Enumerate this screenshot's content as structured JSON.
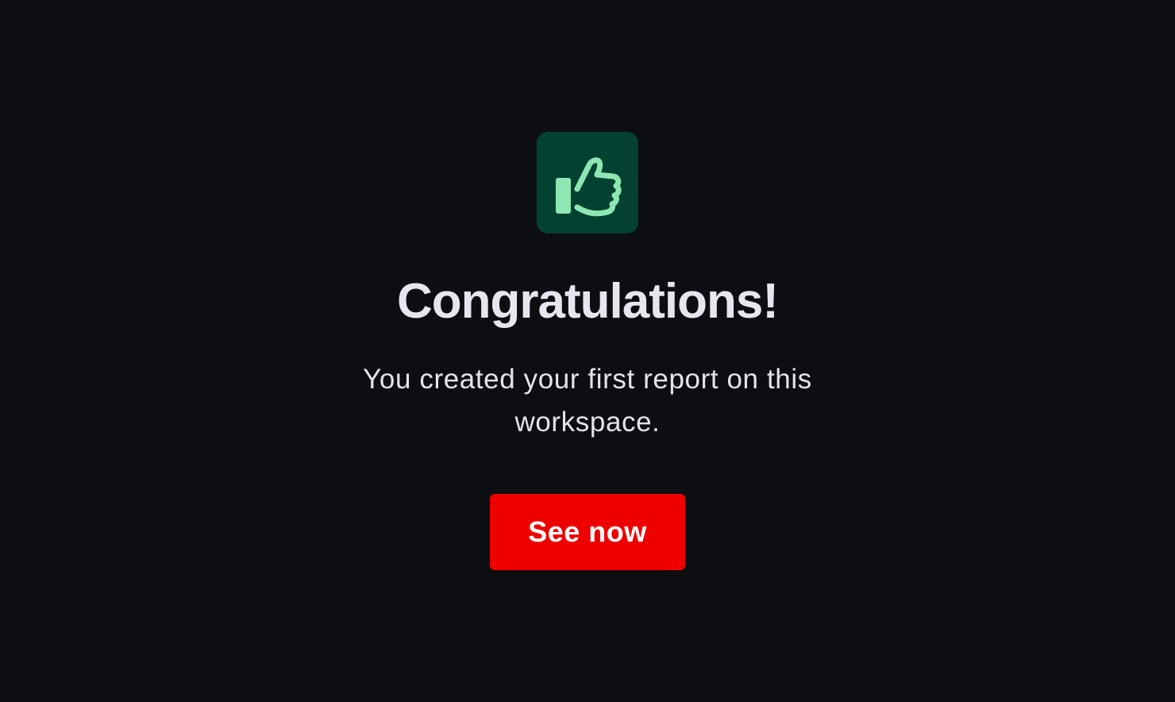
{
  "dialog": {
    "icon": "thumbs-up-icon",
    "title": "Congratulations!",
    "message": "You created your first report on this workspace.",
    "primary_button_label": "See now"
  },
  "colors": {
    "background": "#0c0e11",
    "icon_tile": "#034230",
    "icon_glyph": "#8ee7b2",
    "title_text": "#e6e6ef",
    "body_text": "#e3e3ea",
    "primary_button": "#ee0000",
    "primary_button_text": "#ffffff"
  }
}
